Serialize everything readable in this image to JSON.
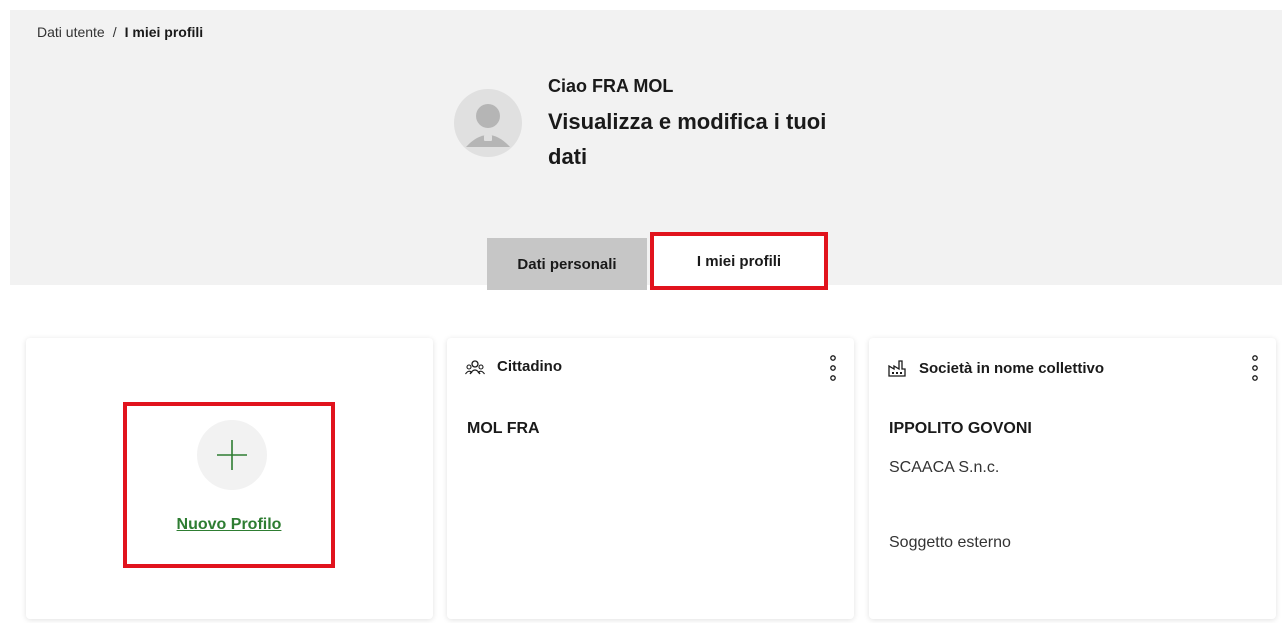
{
  "breadcrumb": {
    "parent": "Dati utente",
    "separator": "/",
    "current": "I miei profili"
  },
  "user": {
    "greeting": "Ciao FRA MOL",
    "subtitle": "Visualizza e modifica i tuoi dati"
  },
  "tabs": [
    {
      "label": "Dati personali",
      "active": false
    },
    {
      "label": "I miei profili",
      "active": true
    }
  ],
  "new_profile": {
    "label": "Nuovo Profilo",
    "icon": "plus-icon"
  },
  "cards": [
    {
      "type": "Cittadino",
      "icon": "people-icon",
      "name": "MOL FRA"
    },
    {
      "type": "Società in nome collettivo",
      "icon": "factory-icon",
      "name": "IPPOLITO GOVONI",
      "company": "SCAACA S.n.c.",
      "role": "Soggetto esterno"
    }
  ],
  "colors": {
    "highlight": "#e1131d",
    "link": "#2e7d32",
    "header_bg": "#f2f2f2",
    "tab_inactive": "#c6c6c6"
  }
}
